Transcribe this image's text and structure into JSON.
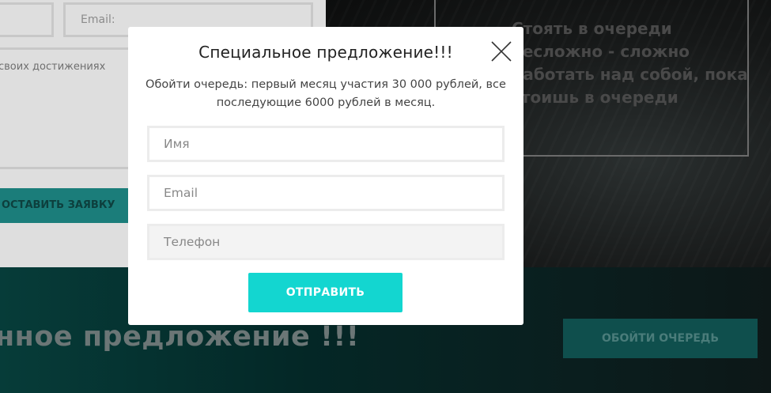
{
  "background": {
    "form": {
      "email_placeholder": "Email:",
      "textarea_placeholder": "своих достижениях",
      "submit_label": "ОСТАВИТЬ ЗАЯВКУ"
    },
    "quote": "Стоять в очереди\nнесложно - сложно\nработать над собой, пока\nстоишь в очереди",
    "bottom_heading": "нное предложение !!!",
    "bottom_button": "ОБОЙТИ ОЧЕРЕДЬ"
  },
  "modal": {
    "title": "Специальное предложение!!!",
    "description": "Обойти очередь: первый месяц участия 30 000 рублей, все последующие 6000 рублей в месяц.",
    "fields": {
      "name_placeholder": "Имя",
      "email_placeholder": "Email",
      "phone_placeholder": "Телефон"
    },
    "submit_label": "ОТПРАВИТЬ",
    "close_icon": "close-icon"
  },
  "colors": {
    "accent": "#13d6d0",
    "dark_teal": "#063c39"
  }
}
